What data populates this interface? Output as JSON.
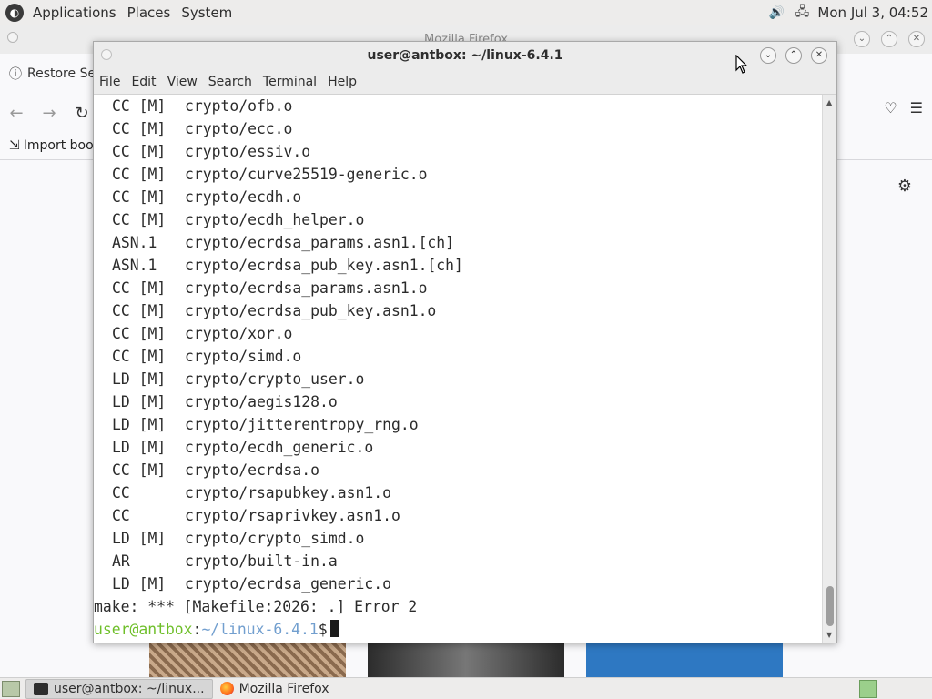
{
  "top_panel": {
    "menus": [
      "Applications",
      "Places",
      "System"
    ],
    "clock": "Mon Jul 3, 04:52"
  },
  "firefox": {
    "title": "Mozilla Firefox",
    "restore_label": "Restore Se",
    "import_bookmarks_label": "Import boo"
  },
  "terminal": {
    "title": "user@antbox: ~/linux-6.4.1",
    "menus": [
      "File",
      "Edit",
      "View",
      "Search",
      "Terminal",
      "Help"
    ],
    "lines": [
      {
        "tag": "CC [M]",
        "path": "crypto/ofb.o"
      },
      {
        "tag": "CC [M]",
        "path": "crypto/ecc.o"
      },
      {
        "tag": "CC [M]",
        "path": "crypto/essiv.o"
      },
      {
        "tag": "CC [M]",
        "path": "crypto/curve25519-generic.o"
      },
      {
        "tag": "CC [M]",
        "path": "crypto/ecdh.o"
      },
      {
        "tag": "CC [M]",
        "path": "crypto/ecdh_helper.o"
      },
      {
        "tag": "ASN.1",
        "path": "crypto/ecrdsa_params.asn1.[ch]"
      },
      {
        "tag": "ASN.1",
        "path": "crypto/ecrdsa_pub_key.asn1.[ch]"
      },
      {
        "tag": "CC [M]",
        "path": "crypto/ecrdsa_params.asn1.o"
      },
      {
        "tag": "CC [M]",
        "path": "crypto/ecrdsa_pub_key.asn1.o"
      },
      {
        "tag": "CC [M]",
        "path": "crypto/xor.o"
      },
      {
        "tag": "CC [M]",
        "path": "crypto/simd.o"
      },
      {
        "tag": "LD [M]",
        "path": "crypto/crypto_user.o"
      },
      {
        "tag": "LD [M]",
        "path": "crypto/aegis128.o"
      },
      {
        "tag": "LD [M]",
        "path": "crypto/jitterentropy_rng.o"
      },
      {
        "tag": "LD [M]",
        "path": "crypto/ecdh_generic.o"
      },
      {
        "tag": "CC [M]",
        "path": "crypto/ecrdsa.o"
      },
      {
        "tag": "CC",
        "path": "crypto/rsapubkey.asn1.o"
      },
      {
        "tag": "CC",
        "path": "crypto/rsaprivkey.asn1.o"
      },
      {
        "tag": "LD [M]",
        "path": "crypto/crypto_simd.o"
      },
      {
        "tag": "AR",
        "path": "crypto/built-in.a"
      },
      {
        "tag": "LD [M]",
        "path": "crypto/ecrdsa_generic.o"
      }
    ],
    "error_line": "make: *** [Makefile:2026: .] Error 2",
    "prompt_user": "user@antbox",
    "prompt_path": "~/linux-6.4.1",
    "prompt_symbol": "$"
  },
  "taskbar": {
    "items": [
      "user@antbox: ~/linux...",
      "Mozilla Firefox"
    ]
  },
  "colors": {
    "prompt_user": "#6fbf2a",
    "prompt_path": "#729fcf"
  }
}
